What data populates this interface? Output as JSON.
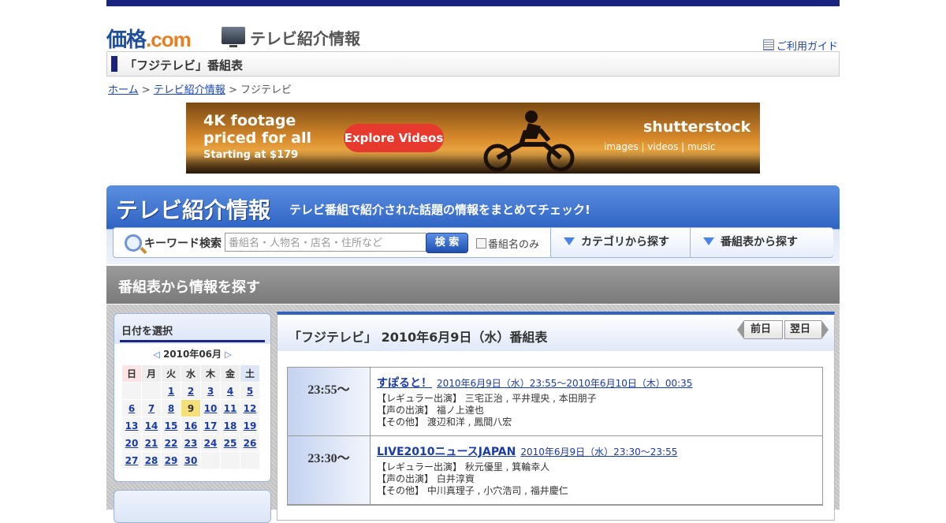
{
  "header": {
    "logo_main": "価格",
    "logo_dot": ".com",
    "subtitle": "テレビ紹介情報",
    "guide_link": "ご利用ガイド"
  },
  "page_title": "「フジテレビ」番組表",
  "breadcrumb": {
    "home": "ホーム",
    "sep1": " > ",
    "tv": "テレビ紹介情報",
    "sep2": " > ",
    "current": "フジテレビ"
  },
  "ad": {
    "line1": "4K footage",
    "line2": "priced for all",
    "line3": "Starting at $179",
    "button": "Explore Videos",
    "brand": "shutterstock",
    "categories": "images  |  videos  |  music"
  },
  "search": {
    "title": "テレビ紹介情報",
    "catch": "テレビ番組で紹介された話題の情報をまとめてチェック!",
    "keyword_label": "キーワード検索",
    "placeholder": "番組名・人物名・店名・住所など",
    "button": "検 索",
    "checkbox_label": "番組名のみ",
    "category_button": "カテゴリから探す",
    "schedule_button": "番組表から探す"
  },
  "section_title": "番組表から情報を探す",
  "calendar": {
    "heading": "日付を選択",
    "month": "2010年06月",
    "weekdays": [
      "日",
      "月",
      "火",
      "水",
      "木",
      "金",
      "土"
    ],
    "weeks": [
      [
        "",
        "",
        "1",
        "2",
        "3",
        "4",
        "5"
      ],
      [
        "6",
        "7",
        "8",
        "9",
        "10",
        "11",
        "12"
      ],
      [
        "13",
        "14",
        "15",
        "16",
        "17",
        "18",
        "19"
      ],
      [
        "20",
        "21",
        "22",
        "23",
        "24",
        "25",
        "26"
      ],
      [
        "27",
        "28",
        "29",
        "30",
        "",
        "",
        ""
      ]
    ],
    "today": "9"
  },
  "schedule": {
    "heading": "「フジテレビ」 2010年6月9日（水）番組表",
    "prev": "前日",
    "next": "翌日",
    "programs": [
      {
        "time": "23:55～",
        "title": "すぽると！",
        "datetime": "2010年6月9日（水）23:55～2010年6月10日（木）00:35",
        "cast": [
          "【レギュラー出演】 三宅正治 , 平井理央 , 本田朋子",
          "【声の出演】 福ノ上達也",
          "【その他】 渡辺和洋 , 鳳間八宏"
        ]
      },
      {
        "time": "23:30～",
        "title": "LIVE2010ニュースJAPAN",
        "datetime": "2010年6月9日（水）23:30～23:55",
        "cast": [
          "【レギュラー出演】 秋元優里 , 箕輪幸人",
          "【声の出演】 白井淳資",
          "【その他】 中川真理子 , 小穴浩司 , 福井慶仁"
        ]
      }
    ]
  }
}
